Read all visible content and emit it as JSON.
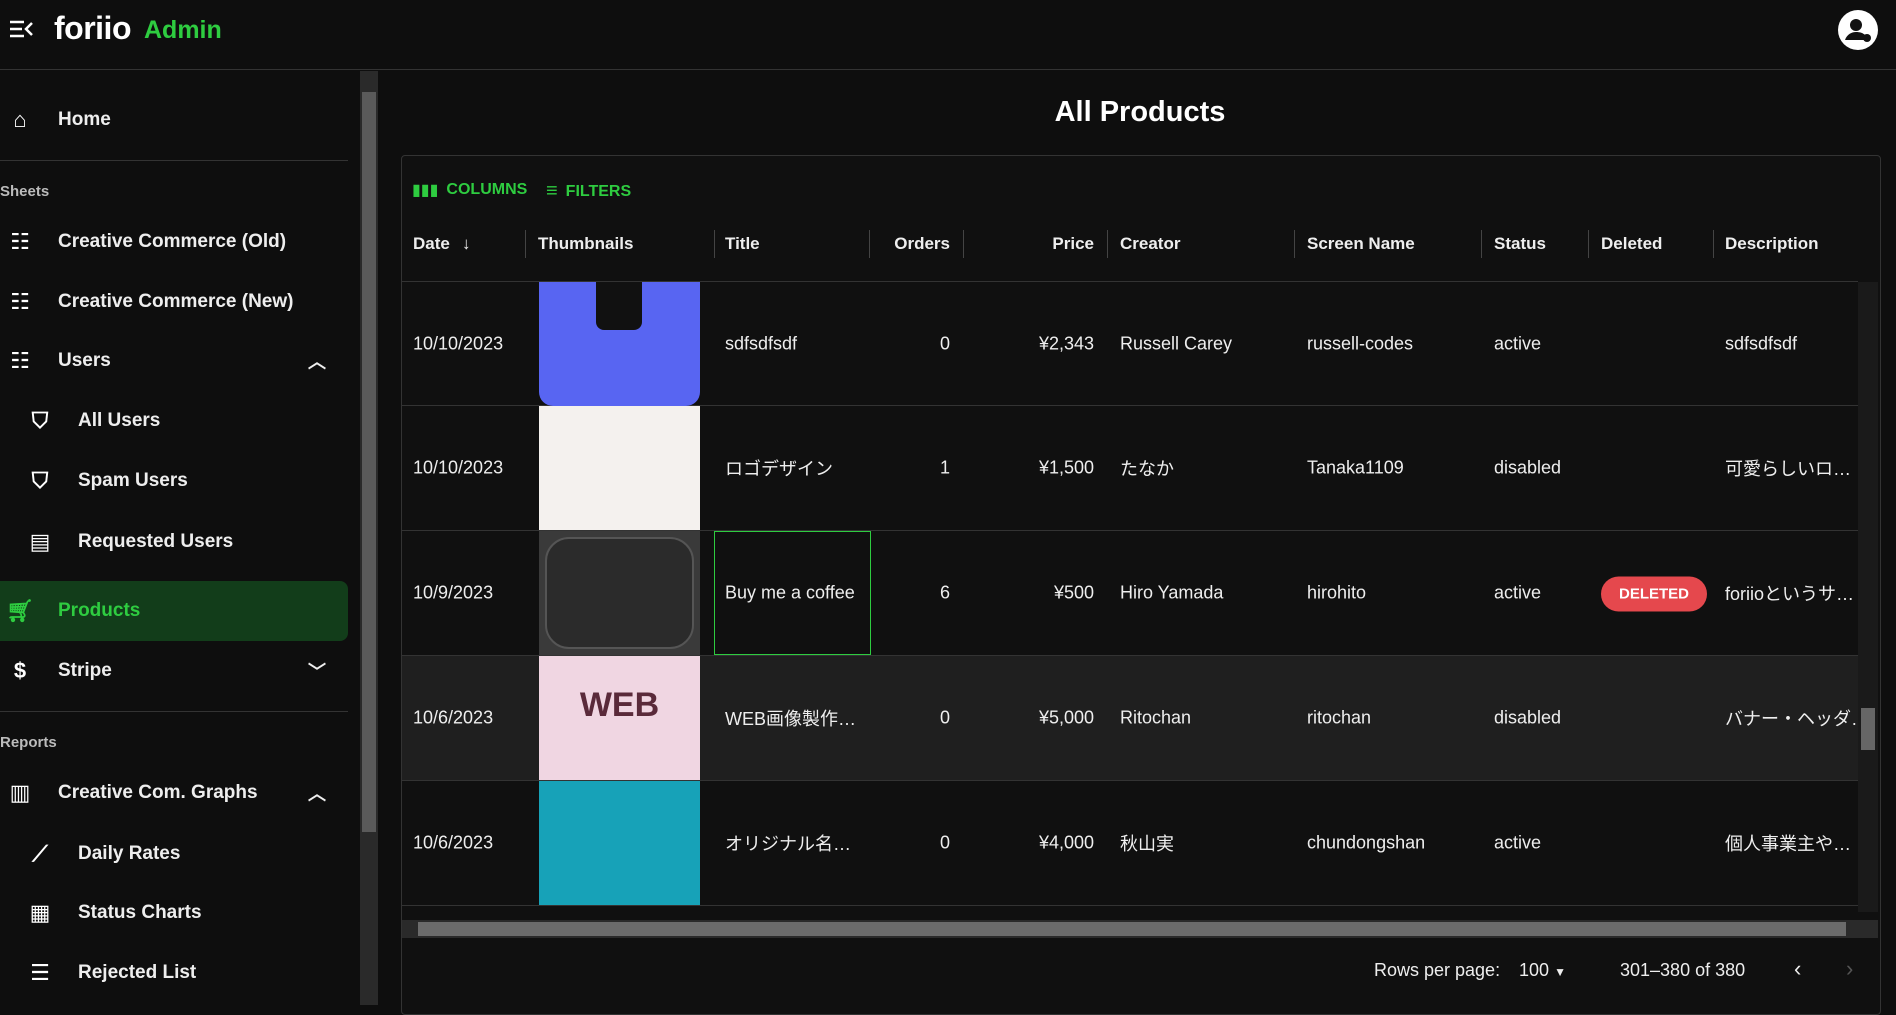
{
  "app": {
    "logo": "foriio",
    "logo_suffix": "Admin",
    "accent": "#2ecc40"
  },
  "sidebar": {
    "home": "Home",
    "section_sheets": "Sheets",
    "cc_old": "Creative Commerce (Old)",
    "cc_new": "Creative Commerce (New)",
    "users": "Users",
    "all_users": "All Users",
    "spam_users": "Spam Users",
    "requested_users": "Requested Users",
    "products": "Products",
    "stripe": "Stripe",
    "section_reports": "Reports",
    "graphs": "Creative Com. Graphs",
    "daily_rates": "Daily Rates",
    "status_charts": "Status Charts",
    "rejected_list": "Rejected List"
  },
  "main": {
    "title": "All Products",
    "toolbar": {
      "columns": "COLUMNS",
      "filters": "FILTERS"
    },
    "columns": [
      "Date",
      "Thumbnails",
      "Title",
      "Orders",
      "Price",
      "Creator",
      "Screen Name",
      "Status",
      "Deleted",
      "Description"
    ],
    "rows": [
      {
        "date": "10/10/2023",
        "title": "sdfsdfsdf",
        "orders": "0",
        "price": "¥2,343",
        "creator": "Russell Carey",
        "screen_name": "russell-codes",
        "status": "active",
        "deleted": "",
        "description": "sdfsdfsdf",
        "thumb_color": "#5865f2"
      },
      {
        "date": "10/10/2023",
        "title": "ロゴデザイン",
        "orders": "1",
        "price": "¥1,500",
        "creator": "たなか",
        "screen_name": "Tanaka1109",
        "status": "disabled",
        "deleted": "",
        "description": "可愛らしいロ…",
        "thumb_color": "#f4f1ee"
      },
      {
        "date": "10/9/2023",
        "title": "Buy me a coffee",
        "orders": "6",
        "price": "¥500",
        "creator": "Hiro Yamada",
        "screen_name": "hirohito",
        "status": "active",
        "deleted": "DELETED",
        "description": "foriioというサ…",
        "thumb_color": "#3a3a3a"
      },
      {
        "date": "10/6/2023",
        "title": "WEB画像製作…",
        "orders": "0",
        "price": "¥5,000",
        "creator": "Ritochan",
        "screen_name": "ritochan",
        "status": "disabled",
        "deleted": "",
        "description": "バナー・ヘッダ…",
        "thumb_color": "#f0d6e2"
      },
      {
        "date": "10/6/2023",
        "title": "オリジナル名…",
        "orders": "0",
        "price": "¥4,000",
        "creator": "秋山実",
        "screen_name": "chundongshan",
        "status": "active",
        "deleted": "",
        "description": "個人事業主や…",
        "thumb_color": "#17a2b8"
      }
    ],
    "footer": {
      "rows_per_page_label": "Rows per page:",
      "rows_per_page": "100",
      "range": "301–380 of 380"
    }
  }
}
